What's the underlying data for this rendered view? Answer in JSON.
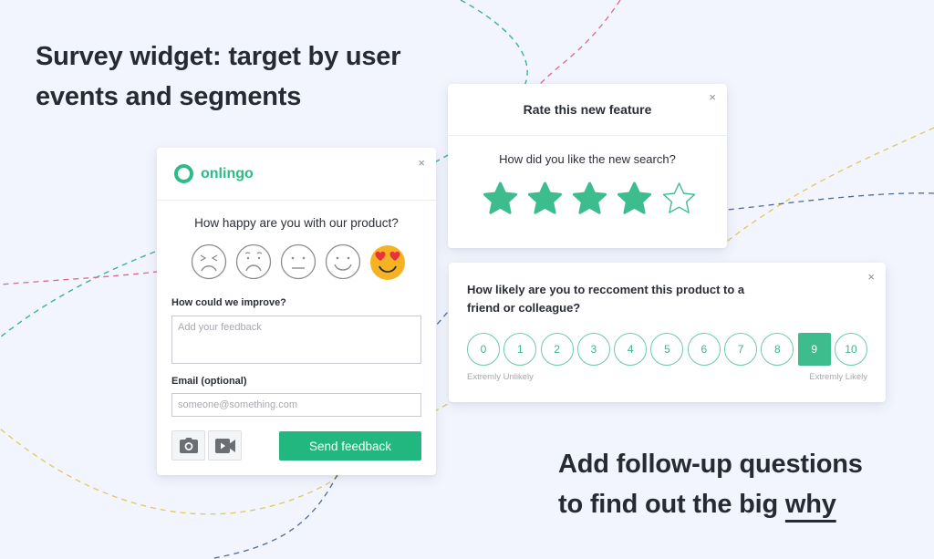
{
  "headlines": {
    "top_line1": "Survey widget: target by user",
    "top_line2": "events and segments",
    "bottom_line1": "Add follow-up questions",
    "bottom_line2_prefix": "to find out the big ",
    "bottom_line2_emphasis": "why"
  },
  "colors": {
    "brand_green": "#21b77f",
    "star_green": "#3dbd8d",
    "background": "#f2f5fd",
    "emoji_yellow": "#f5b323",
    "heart_red": "#e8333f",
    "line_teal": "#3fae9a",
    "line_pink": "#d56b8a",
    "line_yellow": "#e2c75a",
    "line_navy": "#4e6a9c"
  },
  "feedback_widget": {
    "logo_icon": "ring-logo-icon",
    "brand_name": "onlingo",
    "close_label": "×",
    "question": "How happy are you with our product?",
    "faces": [
      {
        "name": "very-unhappy",
        "selected": false
      },
      {
        "name": "unhappy",
        "selected": false
      },
      {
        "name": "neutral",
        "selected": false
      },
      {
        "name": "happy",
        "selected": false
      },
      {
        "name": "love",
        "selected": true
      }
    ],
    "improve_label": "How could we improve?",
    "improve_placeholder": "Add your feedback",
    "email_label": "Email (optional)",
    "email_placeholder": "someone@something.com",
    "screenshot_icon": "camera-icon",
    "video_icon": "video-camera-icon",
    "send_label": "Send feedback"
  },
  "rating_widget": {
    "title": "Rate this new feature",
    "close_label": "×",
    "question": "How did you like the new search?",
    "rating": 4,
    "max_rating": 5
  },
  "nps_widget": {
    "close_label": "×",
    "question": "How likely are you to reccoment this product to a friend or colleague?",
    "scale": [
      "0",
      "1",
      "2",
      "3",
      "4",
      "5",
      "6",
      "7",
      "8",
      "9",
      "10"
    ],
    "selected": "9",
    "low_label": "Extremly Unlikely",
    "high_label": "Extremly Likely"
  }
}
